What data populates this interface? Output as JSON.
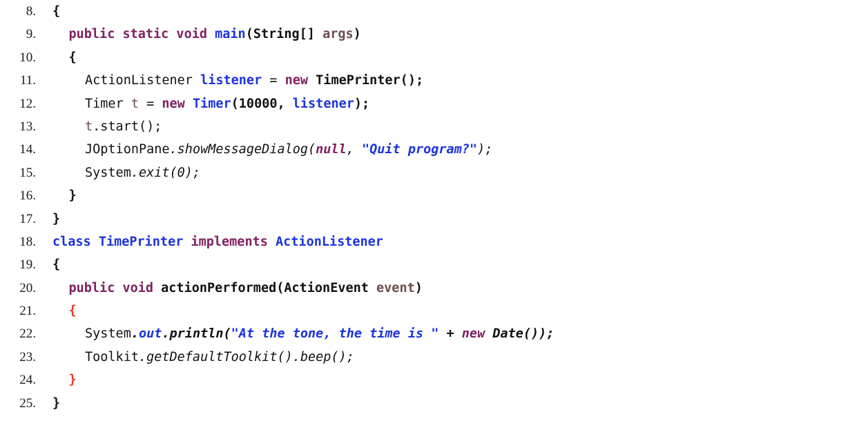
{
  "listing": {
    "language": "java",
    "first_line_number": 8,
    "last_line_number": 25,
    "background_color": "#ffffff",
    "colors": {
      "plain": "#111111",
      "keyword": "#7f2060",
      "type": "#1a33dd",
      "field": "#1a33dd",
      "string": "#1a33dd",
      "local_variable": "#6d4c4c",
      "matched_brace": "#e8392a"
    },
    "lines": [
      {
        "number": "8.",
        "indent": 0,
        "text": "{",
        "tokens": [
          {
            "text": "{",
            "style": "t-plain-b"
          }
        ]
      },
      {
        "number": "9.",
        "indent": 1,
        "text": "public static void main(String[] args)",
        "tokens": [
          {
            "text": "public static void ",
            "style": "t-keyword"
          },
          {
            "text": "main",
            "style": "t-type"
          },
          {
            "text": "(String[] ",
            "style": "t-plain-b"
          },
          {
            "text": "args",
            "style": "t-local-b"
          },
          {
            "text": ")",
            "style": "t-plain-b"
          }
        ]
      },
      {
        "number": "10.",
        "indent": 1,
        "text": "{",
        "tokens": [
          {
            "text": "{",
            "style": "t-plain-b"
          }
        ]
      },
      {
        "number": "11.",
        "indent": 2,
        "text": "ActionListener listener = new TimePrinter();",
        "tokens": [
          {
            "text": "ActionListener ",
            "style": "t-plain"
          },
          {
            "text": "listener",
            "style": "t-field"
          },
          {
            "text": " = ",
            "style": "t-plain"
          },
          {
            "text": "new",
            "style": "t-keyword"
          },
          {
            "text": " TimePrinter();",
            "style": "t-plain-b"
          }
        ]
      },
      {
        "number": "12.",
        "indent": 2,
        "text": "Timer t = new Timer(10000, listener);",
        "tokens": [
          {
            "text": "Timer ",
            "style": "t-plain"
          },
          {
            "text": "t",
            "style": "t-local"
          },
          {
            "text": " = ",
            "style": "t-plain"
          },
          {
            "text": "new",
            "style": "t-keyword"
          },
          {
            "text": " ",
            "style": "t-plain"
          },
          {
            "text": "Timer",
            "style": "t-type"
          },
          {
            "text": "(10000, ",
            "style": "t-plain-b"
          },
          {
            "text": "listener",
            "style": "t-field"
          },
          {
            "text": ");",
            "style": "t-plain-b"
          }
        ]
      },
      {
        "number": "13.",
        "indent": 2,
        "text": "t.start();",
        "tokens": [
          {
            "text": "t",
            "style": "t-local"
          },
          {
            "text": ".start();",
            "style": "t-plain"
          }
        ]
      },
      {
        "number": "14.",
        "indent": 2,
        "text": "JOptionPane.showMessageDialog(null, \"Quit program?\");",
        "tokens": [
          {
            "text": "JOptionPane",
            "style": "t-plain"
          },
          {
            "text": ".showMessageDialog(",
            "style": "t-plain-i"
          },
          {
            "text": "null",
            "style": "t-keyword-i"
          },
          {
            "text": ", ",
            "style": "t-plain-i"
          },
          {
            "text": "\"Quit program?\"",
            "style": "t-string"
          },
          {
            "text": ");",
            "style": "t-plain-i"
          }
        ]
      },
      {
        "number": "15.",
        "indent": 2,
        "text": "System.exit(0);",
        "tokens": [
          {
            "text": "System",
            "style": "t-plain"
          },
          {
            "text": ".exit(0);",
            "style": "t-plain-i"
          }
        ]
      },
      {
        "number": "16.",
        "indent": 1,
        "text": "}",
        "tokens": [
          {
            "text": "}",
            "style": "t-plain-b"
          }
        ]
      },
      {
        "number": "17.",
        "indent": 0,
        "text": "}",
        "tokens": [
          {
            "text": "}",
            "style": "t-plain-b"
          }
        ]
      },
      {
        "number": "18.",
        "indent": 0,
        "text": "class TimePrinter implements ActionListener",
        "tokens": [
          {
            "text": "class TimePrinter ",
            "style": "t-type"
          },
          {
            "text": "implements",
            "style": "t-keyword"
          },
          {
            "text": " ",
            "style": "t-plain-b"
          },
          {
            "text": "ActionListener",
            "style": "t-type"
          }
        ]
      },
      {
        "number": "19.",
        "indent": 0,
        "text": "{",
        "tokens": [
          {
            "text": "{",
            "style": "t-plain-b"
          }
        ]
      },
      {
        "number": "20.",
        "indent": 1,
        "text": "public void actionPerformed(ActionEvent event)",
        "tokens": [
          {
            "text": "public void ",
            "style": "t-keyword"
          },
          {
            "text": "actionPerformed(ActionEvent ",
            "style": "t-plain-b"
          },
          {
            "text": "event",
            "style": "t-local-b"
          },
          {
            "text": ")",
            "style": "t-plain-b"
          }
        ]
      },
      {
        "number": "21.",
        "indent": 1,
        "text": "{",
        "tokens": [
          {
            "text": "{",
            "style": "t-brace-hl"
          }
        ]
      },
      {
        "number": "22.",
        "indent": 2,
        "text": "System.out.println(\"At the tone, the time is \" + new Date());",
        "tokens": [
          {
            "text": "System",
            "style": "t-plain"
          },
          {
            "text": ".",
            "style": "t-plain-bi"
          },
          {
            "text": "out",
            "style": "t-field-i"
          },
          {
            "text": ".println(",
            "style": "t-plain-bi"
          },
          {
            "text": "\"At the tone, the time is \"",
            "style": "t-string"
          },
          {
            "text": " + ",
            "style": "t-plain-bi"
          },
          {
            "text": "new",
            "style": "t-keyword-i"
          },
          {
            "text": " Date());",
            "style": "t-plain-bi"
          }
        ]
      },
      {
        "number": "23.",
        "indent": 2,
        "text": "Toolkit.getDefaultToolkit().beep();",
        "tokens": [
          {
            "text": "Toolkit",
            "style": "t-plain"
          },
          {
            "text": ".getDefaultToolkit().beep();",
            "style": "t-plain-i"
          }
        ]
      },
      {
        "number": "24.",
        "indent": 1,
        "text": "}",
        "tokens": [
          {
            "text": "}",
            "style": "t-brace-hl"
          }
        ]
      },
      {
        "number": "25.",
        "indent": 0,
        "text": "}",
        "tokens": [
          {
            "text": "}",
            "style": "t-plain-b"
          }
        ]
      }
    ]
  }
}
